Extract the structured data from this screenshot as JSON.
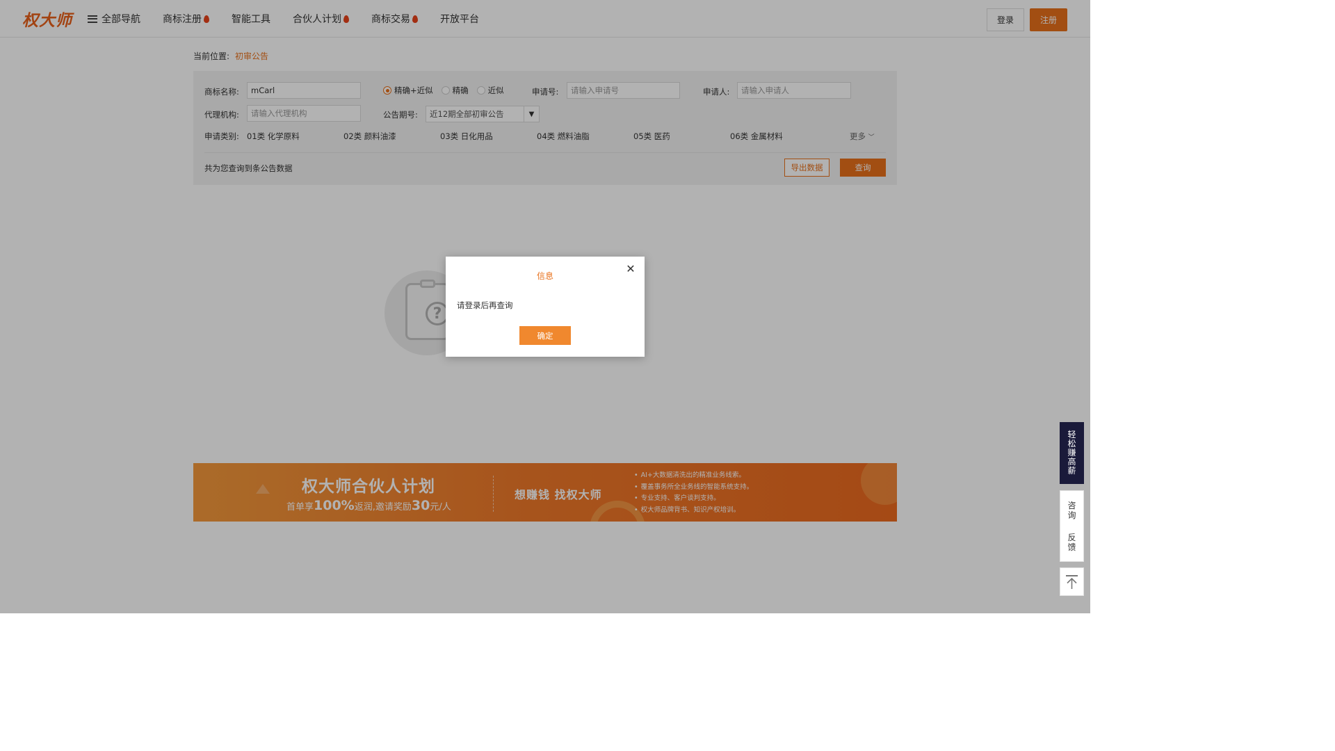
{
  "header": {
    "logo": "权大师",
    "nav": [
      {
        "label": "全部导航",
        "icon": "menu-icon",
        "hot": false
      },
      {
        "label": "商标注册",
        "hot": true
      },
      {
        "label": "智能工具",
        "hot": false
      },
      {
        "label": "合伙人计划",
        "hot": true
      },
      {
        "label": "商标交易",
        "hot": true
      },
      {
        "label": "开放平台",
        "hot": false
      }
    ],
    "login_label": "登录",
    "register_label": "注册"
  },
  "breadcrumb": {
    "prefix": "当前位置:",
    "current": "初审公告"
  },
  "search": {
    "trademark_label": "商标名称:",
    "trademark_value": "mCarl",
    "match_options": [
      {
        "label": "精确+近似",
        "checked": true
      },
      {
        "label": "精确",
        "checked": false
      },
      {
        "label": "近似",
        "checked": false
      }
    ],
    "appno_label": "申请号:",
    "appno_placeholder": "请输入申请号",
    "applicant_label": "申请人:",
    "applicant_placeholder": "请输入申请人",
    "agency_label": "代理机构:",
    "agency_placeholder": "请输入代理机构",
    "period_label": "公告期号:",
    "period_value": "近12期全部初审公告",
    "category_label": "申请类别:",
    "categories": [
      "01类 化学原料",
      "02类 颜料油漆",
      "03类 日化用品",
      "04类 燃料油脂",
      "05类 医药",
      "06类 金属材料"
    ],
    "more_label": "更多",
    "result_text": "共为您查询到条公告数据",
    "export_label": "导出数据",
    "query_label": "查询"
  },
  "banner": {
    "title": "权大师合伙人计划",
    "sub_pre": "首单享",
    "sub_pct": "100%",
    "sub_mid": "返润,邀请奖励",
    "sub_amt": "30",
    "sub_post": "元/人",
    "slogan": "想赚钱  找权大师",
    "bullets": [
      "AI+大数据清洗出的精准业务线索。",
      "覆盖事务所全业务线的智能系统支持。",
      "专业支持、客户谈判支持。",
      "权大师品牌背书、知识产权培训。"
    ]
  },
  "modal": {
    "title": "信息",
    "message": "请登录后再查询",
    "ok_label": "确定"
  },
  "side": {
    "earn": [
      "轻",
      "松",
      "赚",
      "高",
      "薪"
    ],
    "consult": [
      "咨",
      "询"
    ],
    "feedback": [
      "反",
      "馈"
    ]
  },
  "colors": {
    "brand_orange": "#e8701b",
    "side_dark": "#1a1a3a"
  }
}
